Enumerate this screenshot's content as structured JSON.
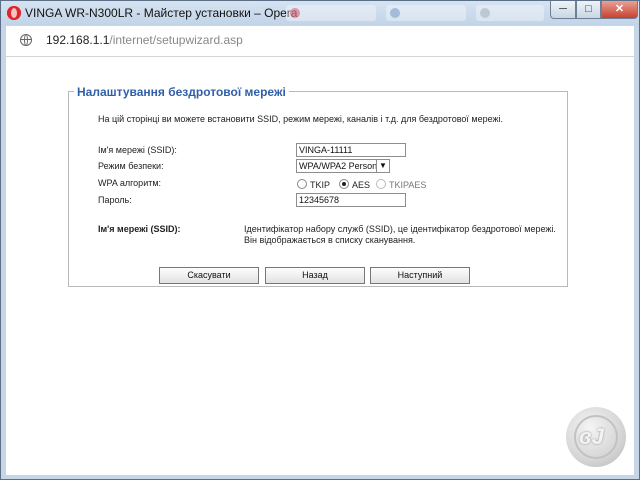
{
  "window": {
    "title": "VINGA WR-N300LR - Майстер установки – Opera",
    "minimize_label": "─",
    "maximize_label": "□",
    "close_label": "✕"
  },
  "address": {
    "host": "192.168.1.1",
    "path": "/internet/setupwizard.asp"
  },
  "form": {
    "legend": "Налаштування бездротової мережі",
    "intro": "На цій сторінці ви можете встановити SSID, режим мережі, каналів і т.д. для бездротової мережі.",
    "fields": {
      "ssid_label": "Ім'я мережі (SSID):",
      "ssid_value": "VINGA-11111",
      "security_label": "Режим безпеки:",
      "security_value": "WPA/WPA2 Personal",
      "wpa_label": "WPA алгоритм:",
      "wpa_options": [
        "TKIP",
        "AES",
        "TKIPAES"
      ],
      "wpa_selected": "AES",
      "password_label": "Пароль:",
      "password_value": "12345678"
    },
    "help": {
      "title": "Ім'я мережі (SSID):",
      "text": "Ідентифікатор набору служб (SSID), це ідентифікатор бездротової мережі. Він відображається в списку сканування."
    },
    "buttons": {
      "cancel": "Скасувати",
      "back": "Назад",
      "next": "Наступний"
    }
  },
  "icons": {
    "app": "opera-icon",
    "address": "globe-icon",
    "select_arrow": "chevron-down-icon",
    "watermark": "watermark-logo"
  }
}
